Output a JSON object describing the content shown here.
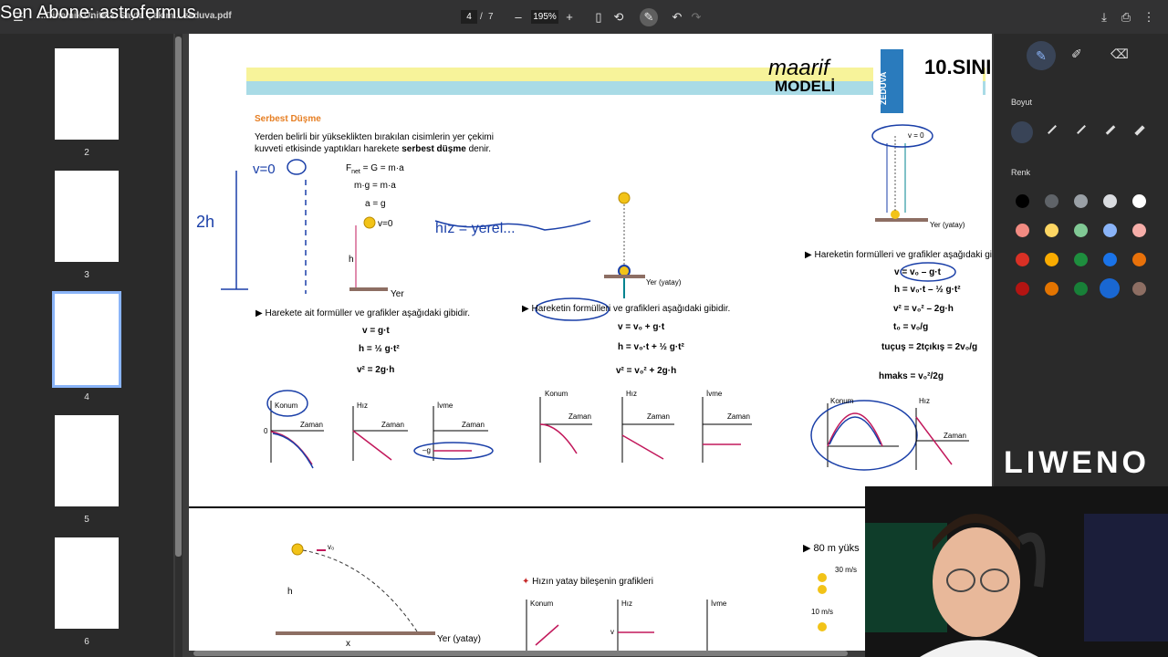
{
  "overlay": {
    "title": "Son Abone: astrofermus"
  },
  "toolbar": {
    "file_name": "...Dinamik Ünite 3. Sayfa Çekim... zeduva.pdf",
    "page_current": "4",
    "page_sep": "/",
    "page_total": "7",
    "zoom": "195%",
    "menu_icon": "menu-icon",
    "minus_label": "–",
    "plus_label": "+"
  },
  "sidebar": {
    "pages": [
      {
        "num": "2"
      },
      {
        "num": "3"
      },
      {
        "num": "4"
      },
      {
        "num": "5"
      },
      {
        "num": "6"
      }
    ],
    "selected": "4"
  },
  "doc": {
    "header": {
      "brand1": "maarif",
      "brand2": "MODELİ",
      "publisher": "ZEDUVA",
      "grade": "10.SINI"
    },
    "section_title": "Serbest Düşme",
    "intro_line1": "Yerden belirli bir yükseklikten bırakılan cisimlerin yer çekimi",
    "intro_line2_a": "kuvveti etkisinde yaptıkları harekete ",
    "intro_line2_b": "serbest düşme",
    "intro_line2_c": " denir.",
    "eq1": "F",
    "eq1_sub": "net",
    "eq1_rest": " = G = m·a",
    "eq2": "m·g = m·a",
    "eq3": "a = g",
    "v0_label": "v=0",
    "h_label": "h",
    "yer_label": "Yer",
    "col1_heading": "Harekete ait formüller ve grafikler aşağıdaki gibidir.",
    "col1_f1": "v = g·t",
    "col1_f2": "h = ½ g·t²",
    "col1_f3": "v² = 2g·h",
    "col2_heading": "Hareketin formülleri ve grafikleri aşağıdaki gibidir.",
    "col2_f1": "v = v₀ + g·t",
    "col2_f2": "h = v₀·t + ½ g·t²",
    "col2_f3": "v² = v₀² + 2g·h",
    "col2_yer": "Yer (yatay)",
    "col3_heading": "Hareketin formülleri ve grafikler aşağıdaki gi",
    "col3_f1": "v = v₀ – g·t",
    "col3_f2": "h = v₀·t – ½ g·t²",
    "col3_f3": "v² = v₀² – 2g·h",
    "col3_f4": "t₀ = v₀/g",
    "col3_f5": "tuçuş = 2tçıkış = 2v₀/g",
    "col3_f6": "hmaks = v₀²/2g",
    "col3_yer": "Yer (yatay)",
    "col3_v0": "v = 0",
    "graph_labels": {
      "konum": "Konum",
      "hiz": "Hız",
      "ivme": "İvme",
      "zaman": "Zaman",
      "zero": "0",
      "minus_g": "–g",
      "g": "g",
      "minus_v0": "–v₀",
      "v0": "v₀",
      "t0": "t₀",
      "hmaks": "hmaks"
    },
    "handwriting": {
      "h1": "v=0",
      "h2": "2h",
      "h3": "hız = yerel..."
    },
    "lower": {
      "horizontal_title": "Hızın yatay bileşenin grafikleri",
      "konum": "Konum",
      "hiz": "Hız",
      "ivme": "İvme",
      "h": "h",
      "x": "x",
      "v0": "v₀",
      "v": "v",
      "yer": "Yer (yatay)",
      "right_title": "80 m yüks",
      "speed1": "30 m/s",
      "speed2": "30",
      "speed3": "10 m/s",
      "speed4": "10"
    }
  },
  "right_panel": {
    "size_label": "Boyut",
    "color_label": "Renk",
    "colors": [
      "#000000",
      "#5f6368",
      "#9aa0a6",
      "#dadce0",
      "#ffffff",
      "#f28b82",
      "#fdd663",
      "#81c995",
      "#8ab4f8",
      "#f6aea9",
      "#d93025",
      "#f9ab00",
      "#1e8e3e",
      "#1a73e8",
      "#e8710a",
      "#b31412",
      "#e37400",
      "#188038",
      "#1967d2",
      "#8d6e63"
    ],
    "selected_color": "#1967d2"
  },
  "brand_overlay": "LIWENO"
}
